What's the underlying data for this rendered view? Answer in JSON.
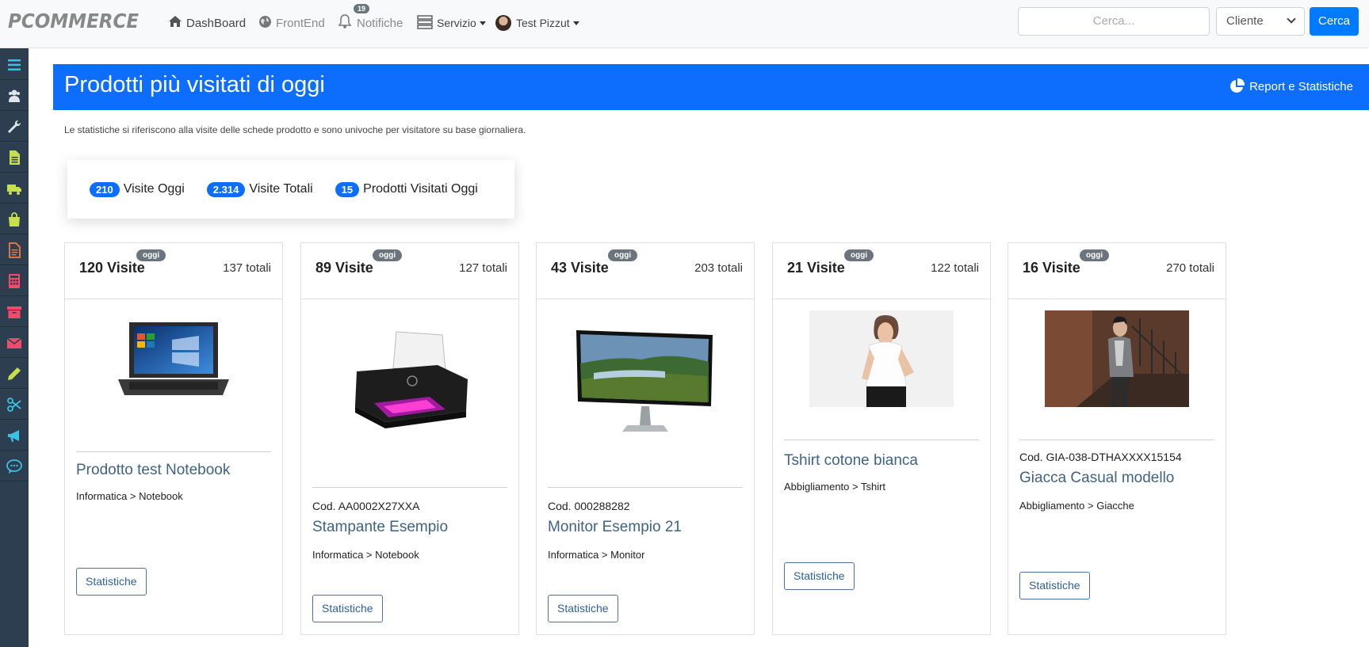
{
  "brand": {
    "logo": "PCOMMERCE"
  },
  "nav": {
    "dashboard": "DashBoard",
    "frontend": "FrontEnd",
    "notifiche": "Notifiche",
    "notifiche_count": "19",
    "servizio": "Servizio",
    "user": "Test Pizzut"
  },
  "search": {
    "placeholder": "Cerca...",
    "select_value": "Cliente",
    "button": "Cerca"
  },
  "sidebar": {
    "items": [
      {
        "icon": "menu-icon",
        "color": "#3bc0e6"
      },
      {
        "icon": "users-icon",
        "color": "#dfe6ec"
      },
      {
        "icon": "wrench-icon",
        "color": "#dfe6ec"
      },
      {
        "icon": "document-icon",
        "color": "#c6e04a"
      },
      {
        "icon": "truck-icon",
        "color": "#c6e04a"
      },
      {
        "icon": "shopping-bag-icon",
        "color": "#c6e04a"
      },
      {
        "icon": "invoice-icon",
        "color": "#f07b42"
      },
      {
        "icon": "calculator-icon",
        "color": "#f2496c"
      },
      {
        "icon": "archive-icon",
        "color": "#f2496c"
      },
      {
        "icon": "envelope-icon",
        "color": "#f2496c"
      },
      {
        "icon": "pencil-icon",
        "color": "#c6e04a"
      },
      {
        "icon": "scissors-icon",
        "color": "#3bc0e6"
      },
      {
        "icon": "megaphone-icon",
        "color": "#3bc0e6"
      },
      {
        "icon": "chat-icon",
        "color": "#3bc0e6"
      }
    ]
  },
  "header": {
    "title": "Prodotti più visitati di oggi",
    "report_link": "Report e Statistiche"
  },
  "intro": "Le statistiche si riferiscono alla visite delle schede prodotto e sono univoche per visitatore su base giornaliera.",
  "stats": [
    {
      "value": "210",
      "label": "Visite Oggi"
    },
    {
      "value": "2.314",
      "label": "Visite Totali"
    },
    {
      "value": "15",
      "label": "Prodotti Visitati Oggi"
    }
  ],
  "oggi_label": "oggi",
  "stat_button_label": "Statistiche",
  "cards": [
    {
      "visits": "120 Visite",
      "total": "137 totali",
      "code": "",
      "name": "Prodotto test Notebook",
      "category": "Informatica > Notebook",
      "image": "laptop"
    },
    {
      "visits": "89 Visite",
      "total": "127 totali",
      "code": "Cod. AA0002X27XXA",
      "name": "Stampante Esempio",
      "category": "Informatica > Notebook",
      "image": "printer"
    },
    {
      "visits": "43 Visite",
      "total": "203 totali",
      "code": "Cod. 000288282",
      "name": "Monitor Esempio 21",
      "category": "Informatica > Monitor",
      "image": "monitor"
    },
    {
      "visits": "21 Visite",
      "total": "122 totali",
      "code": "",
      "name": "Tshirt cotone bianca",
      "category": "Abbigliamento > Tshirt",
      "image": "tshirt"
    },
    {
      "visits": "16 Visite",
      "total": "270 totali",
      "code": "Cod. GIA-038-DTHAXXXX15154",
      "name": "Giacca Casual modello",
      "category": "Abbigliamento > Giacche",
      "image": "jacket"
    }
  ]
}
